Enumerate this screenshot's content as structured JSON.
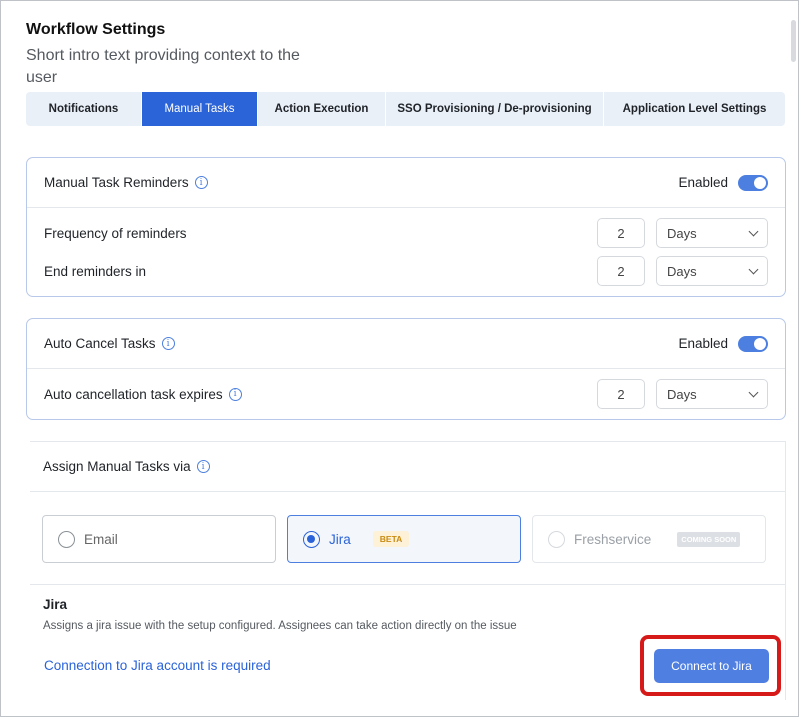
{
  "header": {
    "title": "Workflow Settings",
    "intro": "Short intro text providing context to the user"
  },
  "tabs": [
    {
      "label": "Notifications",
      "active": false
    },
    {
      "label": "Manual Tasks",
      "active": true
    },
    {
      "label": "Action Execution",
      "active": false
    },
    {
      "label": "SSO Provisioning / De-provisioning",
      "active": false
    },
    {
      "label": "Application Level Settings",
      "active": false
    }
  ],
  "reminders": {
    "title": "Manual Task Reminders",
    "status": "Enabled",
    "rows": [
      {
        "label": "Frequency of reminders",
        "value": "2",
        "unit": "Days"
      },
      {
        "label": "End reminders in",
        "value": "2",
        "unit": "Days"
      }
    ]
  },
  "auto_cancel": {
    "title": "Auto Cancel Tasks",
    "status": "Enabled",
    "row": {
      "label": "Auto cancellation task expires",
      "value": "2",
      "unit": "Days"
    }
  },
  "assign": {
    "title": "Assign Manual Tasks via",
    "options": [
      {
        "label": "Email"
      },
      {
        "label": "Jira",
        "badge": "BETA"
      },
      {
        "label": "Freshservice",
        "badge": "COMING SOON"
      }
    ],
    "jira": {
      "title": "Jira",
      "description": "Assigns a jira issue with the setup configured. Assignees can take action directly on the issue",
      "requirement": "Connection to Jira account is required",
      "button": "Connect to Jira"
    }
  },
  "icons": {
    "info": "info-icon",
    "chevron": "chevron-down-icon"
  },
  "colors": {
    "accent": "#2b63d9",
    "highlight": "#d61a1a",
    "beta": "#c98a12"
  }
}
